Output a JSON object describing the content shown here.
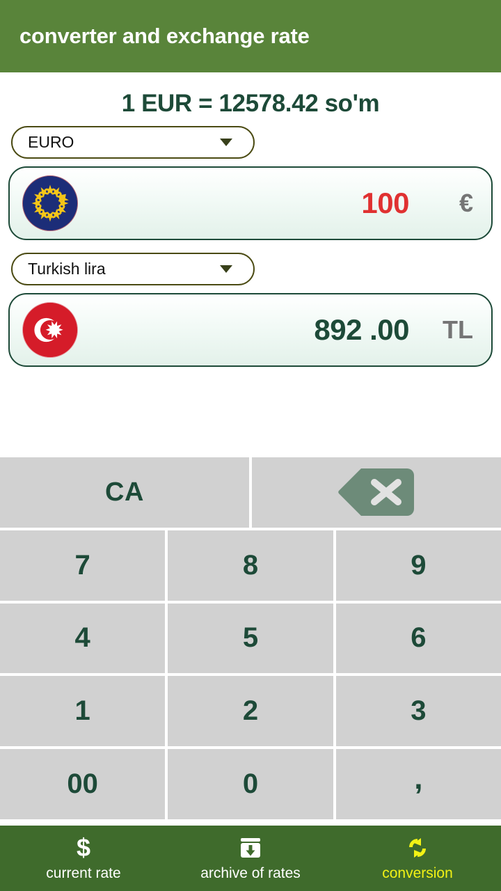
{
  "header": {
    "title": "converter and exchange rate"
  },
  "converter": {
    "rate_line": "1 EUR = 12578.42 so'm",
    "accent_green": "#59843a",
    "nav_green": "#3f6b2c",
    "dark_green": "#1d4a38",
    "from": {
      "currency_label": "EURO",
      "flag_icon": "eu-flag-icon",
      "amount": "100",
      "symbol": "€",
      "amount_color": "#e03131"
    },
    "to": {
      "currency_label": "Turkish lira",
      "flag_icon": "turkish-flag-icon",
      "amount": "892 .00",
      "symbol": "TL",
      "amount_color": "#1d4a38"
    }
  },
  "keypad": {
    "clear_label": "CA",
    "backspace_icon": "backspace-icon",
    "rows": [
      [
        "7",
        "8",
        "9"
      ],
      [
        "4",
        "5",
        "6"
      ],
      [
        "1",
        "2",
        "3"
      ],
      [
        "00",
        "0",
        ","
      ]
    ]
  },
  "bottom_nav": {
    "items": [
      {
        "label": "current rate",
        "icon": "dollar-icon",
        "active": false
      },
      {
        "label": "archive of rates",
        "icon": "archive-download-icon",
        "active": false
      },
      {
        "label": "conversion",
        "icon": "swap-arrows-icon",
        "active": true
      }
    ]
  }
}
